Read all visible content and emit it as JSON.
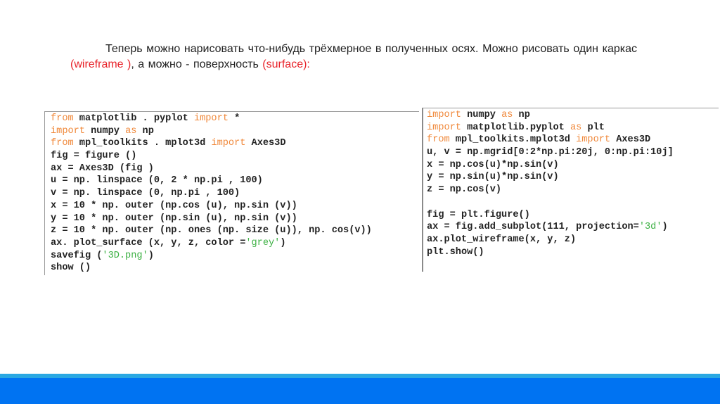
{
  "intro": {
    "part1": "Теперь можно нарисовать что-нибудь трёхмерное в полученных осях. Можно рисовать один каркас ",
    "wireframe": "(wireframe )",
    "part2": ", а можно - поверхность ",
    "surface": "(surface):"
  },
  "code_left": [
    [
      [
        "kw",
        "from"
      ],
      [
        "t",
        " matplotlib . pyplot "
      ],
      [
        "kw",
        "import"
      ],
      [
        "t",
        " *"
      ]
    ],
    [
      [
        "kw",
        "import"
      ],
      [
        "t",
        " numpy "
      ],
      [
        "kw",
        "as"
      ],
      [
        "t",
        " np"
      ]
    ],
    [
      [
        "kw",
        "from"
      ],
      [
        "t",
        " mpl_toolkits . mplot3d "
      ],
      [
        "kw",
        "import"
      ],
      [
        "t",
        " Axes3D"
      ]
    ],
    [
      [
        "t",
        "fig = figure ()"
      ]
    ],
    [
      [
        "t",
        "ax = Axes3D (fig )"
      ]
    ],
    [
      [
        "t",
        "u = np. linspace (0, 2 * np.pi , 100)"
      ]
    ],
    [
      [
        "t",
        "v = np. linspace (0, np.pi , 100)"
      ]
    ],
    [
      [
        "t",
        "x = 10 * np. outer (np.cos (u), np.sin (v))"
      ]
    ],
    [
      [
        "t",
        "y = 10 * np. outer (np.sin (u), np.sin (v))"
      ]
    ],
    [
      [
        "t",
        "z = 10 * np. outer (np. ones (np. size (u)), np. cos(v))"
      ]
    ],
    [
      [
        "t",
        "ax. plot_surface (x, y, z, color ="
      ],
      [
        "str",
        "'grey'"
      ],
      [
        "t",
        ")"
      ]
    ],
    [
      [
        "t",
        "savefig ("
      ],
      [
        "str",
        "'3D.png'"
      ],
      [
        "t",
        ")"
      ]
    ],
    [
      [
        "t",
        "show ()"
      ]
    ]
  ],
  "code_right": [
    [
      [
        "kw",
        "import"
      ],
      [
        "t",
        " numpy "
      ],
      [
        "kw",
        "as"
      ],
      [
        "t",
        " np"
      ]
    ],
    [
      [
        "kw",
        "import"
      ],
      [
        "t",
        " matplotlib.pyplot "
      ],
      [
        "kw",
        "as"
      ],
      [
        "t",
        " plt"
      ]
    ],
    [
      [
        "kw",
        "from"
      ],
      [
        "t",
        " mpl_toolkits.mplot3d "
      ],
      [
        "kw",
        "import"
      ],
      [
        "t",
        " Axes3D"
      ]
    ],
    [
      [
        "t",
        "u, v = np.mgrid[0:2*np.pi:20j, 0:np.pi:10j]"
      ]
    ],
    [
      [
        "t",
        "x = np.cos(u)*np.sin(v)"
      ]
    ],
    [
      [
        "t",
        "y = np.sin(u)*np.sin(v)"
      ]
    ],
    [
      [
        "t",
        "z = np.cos(v)"
      ]
    ],
    [
      [
        "t",
        ""
      ]
    ],
    [
      [
        "t",
        "fig = plt.figure()"
      ]
    ],
    [
      [
        "t",
        "ax = fig.add_subplot(111, projection="
      ],
      [
        "str",
        "'3d'"
      ],
      [
        "t",
        ")"
      ]
    ],
    [
      [
        "t",
        "ax.plot_wireframe(x, y, z)"
      ]
    ],
    [
      [
        "t",
        "plt.show()"
      ]
    ]
  ],
  "colors": {
    "keyword": "#f0883a",
    "string": "#3cb043",
    "highlight": "#e8232a",
    "footer": "#0073f2",
    "stripe": "#2aa8e2"
  }
}
